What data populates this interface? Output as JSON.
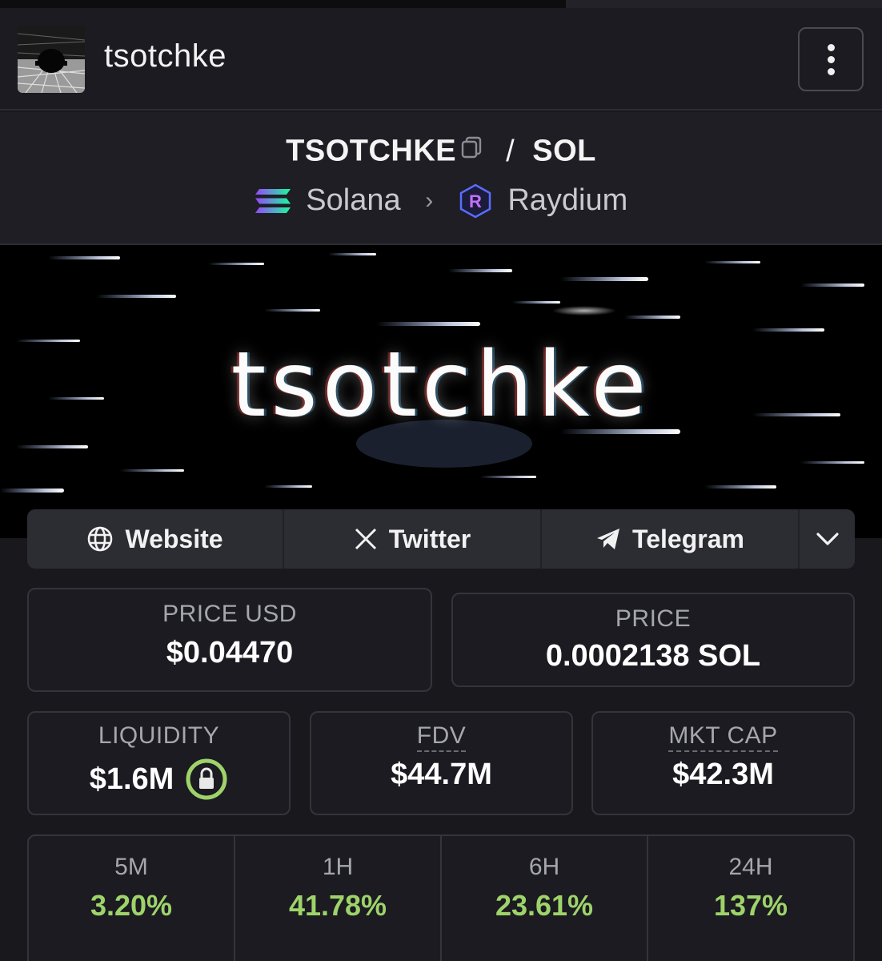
{
  "header": {
    "token_name": "tsotchke",
    "menu_icon": "more-vertical-icon"
  },
  "pair": {
    "base": "TSOTCHKE",
    "separator": "/",
    "quote": "SOL",
    "chain": "Solana",
    "dex": "Raydium"
  },
  "banner": {
    "word": "tsotchke"
  },
  "social": [
    {
      "label": "Website",
      "icon": "globe-icon"
    },
    {
      "label": "Twitter",
      "icon": "x-icon"
    },
    {
      "label": "Telegram",
      "icon": "telegram-icon"
    }
  ],
  "prices": {
    "usd_label": "PRICE USD",
    "usd_value": "$0.04470",
    "native_label": "PRICE",
    "native_value": "0.0002138 SOL"
  },
  "stats": {
    "liquidity_label": "LIQUIDITY",
    "liquidity_value": "$1.6M",
    "fdv_label": "FDV",
    "fdv_value": "$44.7M",
    "mcap_label": "MKT CAP",
    "mcap_value": "$42.3M"
  },
  "changes": [
    {
      "label": "5M",
      "value": "3.20%"
    },
    {
      "label": "1H",
      "value": "41.78%"
    },
    {
      "label": "6H",
      "value": "23.61%"
    },
    {
      "label": "24H",
      "value": "137%"
    }
  ],
  "colors": {
    "positive": "#9ed36a",
    "lock_ring": "#9ed36a",
    "background": "#18181d"
  }
}
